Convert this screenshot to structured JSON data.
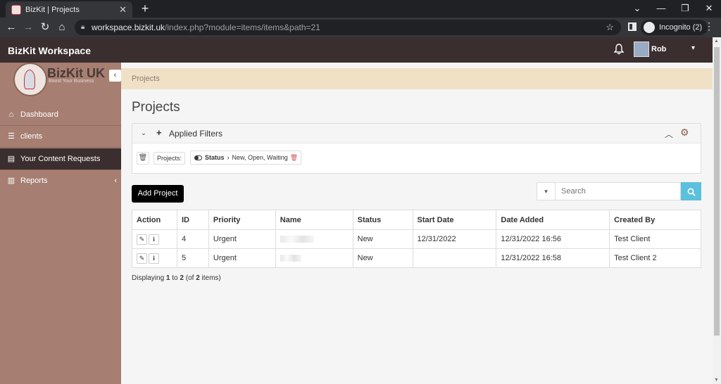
{
  "browser": {
    "tab_title": "BizKit | Projects",
    "tab_close": "✕",
    "new_tab": "+",
    "url_host": "workspace.bizkit.uk",
    "url_path": "/index.php?module=items/items&path=21",
    "incognito_label": "Incognito (2)"
  },
  "app": {
    "brand": "BizKit Workspace",
    "user_name": "Rob"
  },
  "sidebar": {
    "logo_name": "BizKit UK",
    "logo_tagline": "Boost Your Business",
    "items": [
      {
        "label": "Dashboard",
        "icon": "home-icon"
      },
      {
        "label": "clients",
        "icon": "list-icon"
      },
      {
        "label": "Your Content Requests",
        "icon": "document-icon"
      },
      {
        "label": "Reports",
        "icon": "bar-chart-icon"
      }
    ]
  },
  "main": {
    "breadcrumb": "Projects",
    "page_title": "Projects",
    "filters": {
      "title": "Applied Filters",
      "entity_label": "Projects:",
      "chip_field": "Status",
      "chip_value": "New, Open, Waiting"
    },
    "add_button": "Add Project",
    "search_placeholder": "Search",
    "table": {
      "columns": [
        "Action",
        "ID",
        "Priority",
        "Name",
        "Status",
        "Start Date",
        "Date Added",
        "Created By"
      ],
      "rows": [
        {
          "id": "4",
          "priority": "Urgent",
          "status": "New",
          "start_date": "12/31/2022",
          "date_added": "12/31/2022 16:56",
          "created_by": "Test Client"
        },
        {
          "id": "5",
          "priority": "Urgent",
          "status": "New",
          "start_date": "",
          "date_added": "12/31/2022 16:58",
          "created_by": "Test Client 2"
        }
      ]
    },
    "pager": {
      "prefix": "Displaying",
      "from": "1",
      "to_word": "to",
      "to": "2",
      "of_prefix": "(of",
      "total": "2",
      "suffix": "items)"
    }
  },
  "colors": {
    "sidebar": "#a67f72",
    "header": "#3a2e2e",
    "breadcrumb_bg": "#f0e1c6",
    "search_button": "#5bc0de"
  }
}
